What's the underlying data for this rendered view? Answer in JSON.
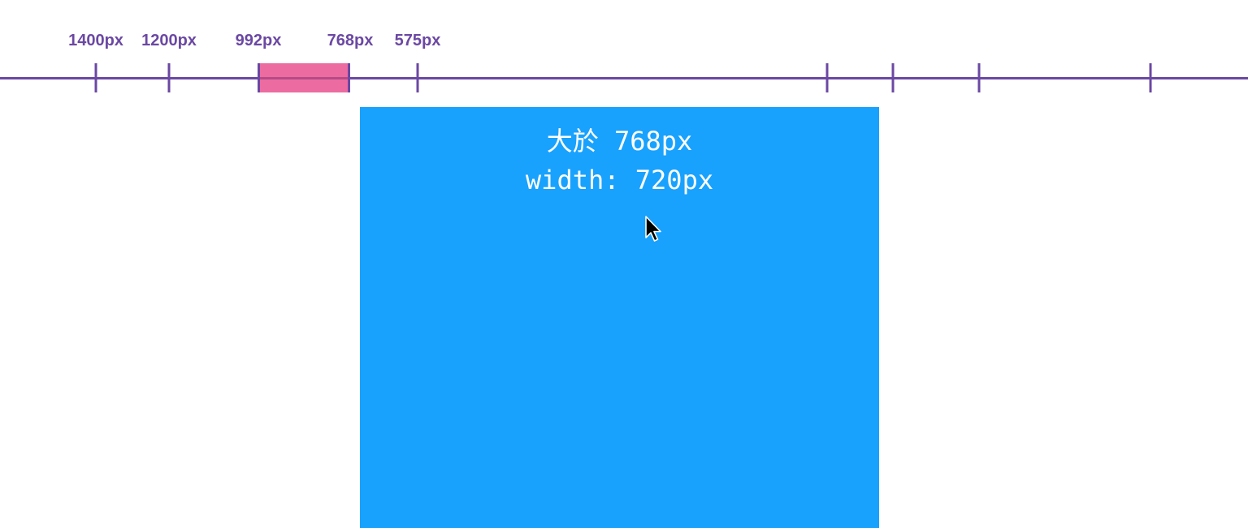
{
  "breakpoints": {
    "labels": [
      "1400px",
      "1200px",
      "992px",
      "768px",
      "575px"
    ]
  },
  "container": {
    "line1": "大於 768px",
    "line2": "width: 720px",
    "color": "#18a2fd"
  },
  "colors": {
    "ruler": "#6b48a3",
    "highlight": "#ec6ba0",
    "background": "#ffffff"
  },
  "icons": {
    "cursor": "mouse-pointer-icon"
  }
}
